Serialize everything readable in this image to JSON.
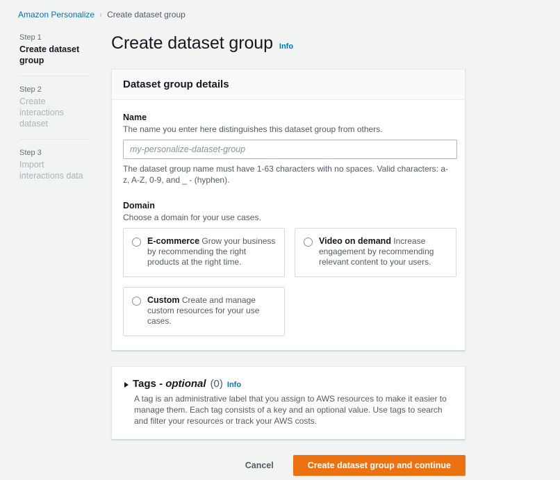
{
  "breadcrumb": {
    "root": "Amazon Personalize",
    "separator": "›",
    "current": "Create dataset group"
  },
  "wizard": {
    "steps": [
      {
        "number": "Step 1",
        "title": "Create dataset group",
        "state": "active"
      },
      {
        "number": "Step 2",
        "title": "Create interactions dataset",
        "state": "inactive"
      },
      {
        "number": "Step 3",
        "title": "Import interactions data",
        "state": "inactive"
      }
    ]
  },
  "page": {
    "title": "Create dataset group",
    "info_label": "Info"
  },
  "details_card": {
    "header": "Dataset group details",
    "name_field": {
      "label": "Name",
      "description": "The name you enter here distinguishes this dataset group from others.",
      "placeholder": "my-personalize-dataset-group",
      "value": "",
      "hint": "The dataset group name must have 1-63 characters with no spaces. Valid characters: a-z, A-Z, 0-9, and _ - (hyphen)."
    },
    "domain_field": {
      "label": "Domain",
      "description": "Choose a domain for your use cases.",
      "selected": null,
      "options": [
        {
          "id": "ecommerce",
          "title": "E-commerce",
          "description": "Grow your business by recommending the right products at the right time.",
          "selected": false
        },
        {
          "id": "video-on-demand",
          "title": "Video on demand",
          "description": "Increase engagement by recommending relevant content to your users.",
          "selected": false
        },
        {
          "id": "custom",
          "title": "Custom",
          "description": "Create and manage custom resources for your use cases.",
          "selected": false
        }
      ]
    }
  },
  "tags_card": {
    "title": "Tags - ",
    "title_optional": "optional",
    "count": "(0)",
    "info_label": "Info",
    "expanded": false,
    "description": "A tag is an administrative label that you assign to AWS resources to make it easier to manage them. Each tag consists of a key and an optional value. Use tags to search and filter your resources or track your AWS costs."
  },
  "actions": {
    "cancel_label": "Cancel",
    "submit_label": "Create dataset group and continue"
  },
  "colors": {
    "accent_orange": "#ec7211",
    "link_blue": "#0073bb",
    "page_background": "#f2f3f3",
    "text_primary": "#16191f",
    "text_secondary": "#545b64",
    "text_disabled": "#aab7b8"
  }
}
